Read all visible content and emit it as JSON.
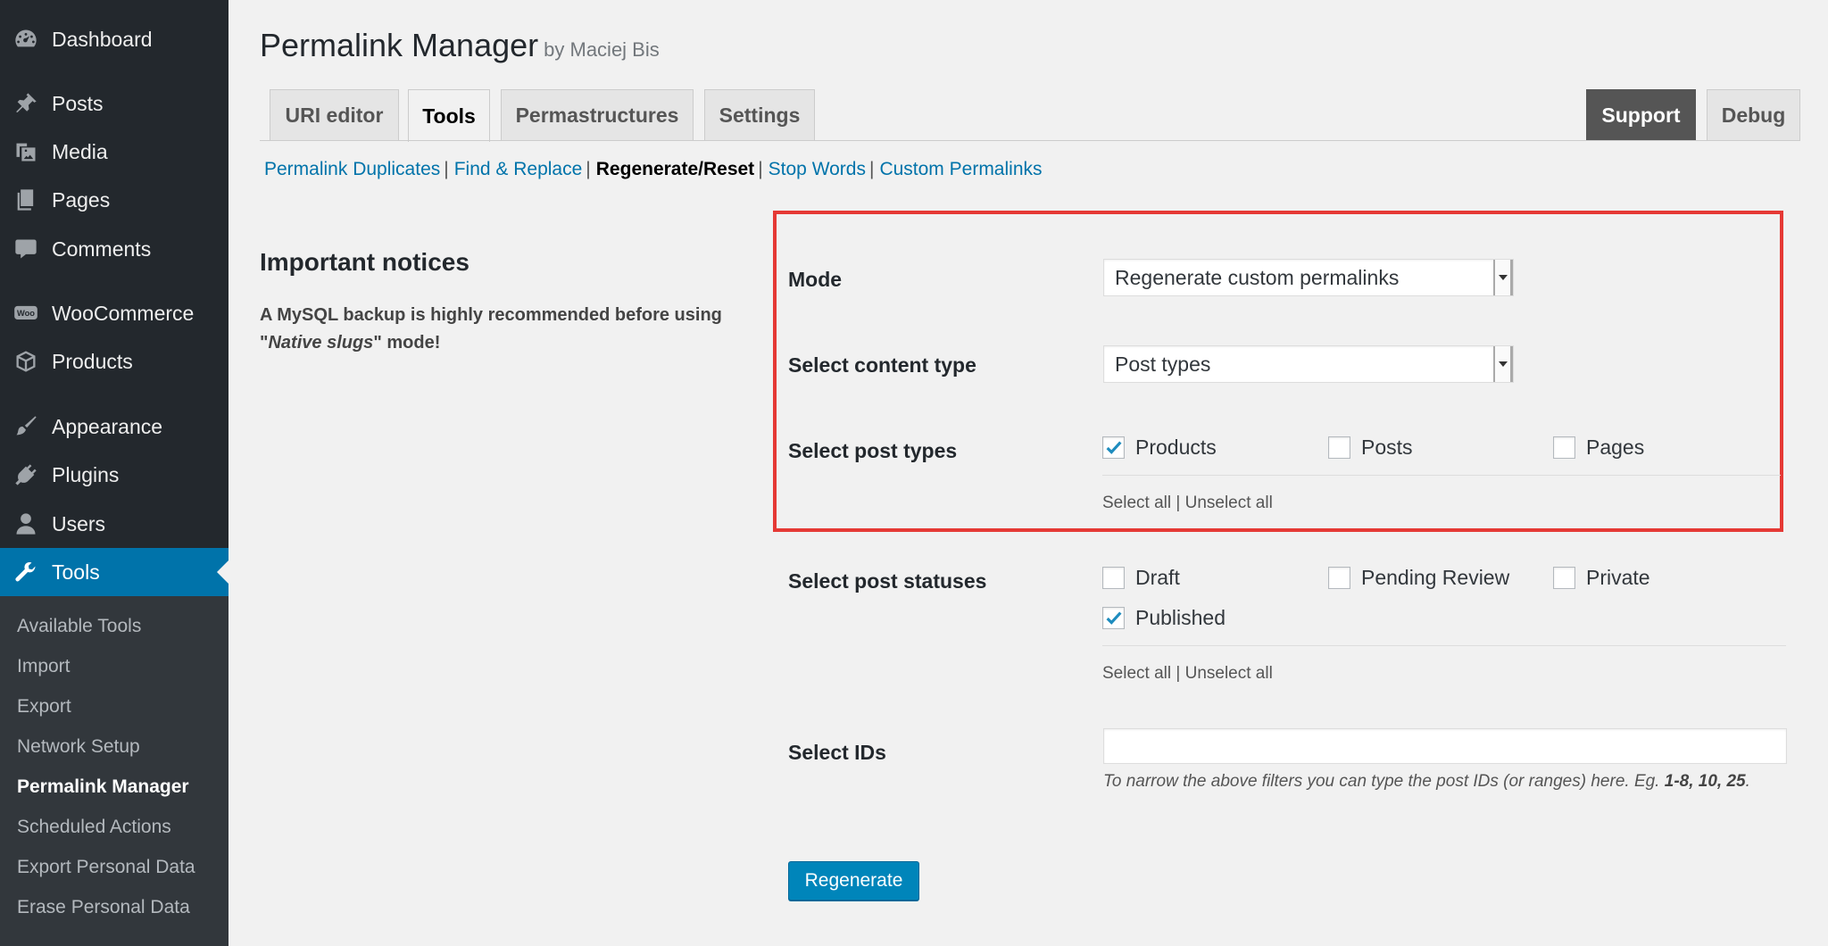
{
  "sidebar": {
    "items": [
      {
        "label": "Dashboard",
        "icon": "dashboard-icon"
      },
      {
        "label": "Posts",
        "icon": "pushpin-icon"
      },
      {
        "label": "Media",
        "icon": "media-icon"
      },
      {
        "label": "Pages",
        "icon": "pages-icon"
      },
      {
        "label": "Comments",
        "icon": "comment-icon"
      },
      {
        "label": "WooCommerce",
        "icon": "woocommerce-icon"
      },
      {
        "label": "Products",
        "icon": "box-icon"
      },
      {
        "label": "Appearance",
        "icon": "paintbrush-icon"
      },
      {
        "label": "Plugins",
        "icon": "plug-icon"
      },
      {
        "label": "Users",
        "icon": "user-icon"
      },
      {
        "label": "Tools",
        "icon": "wrench-icon"
      }
    ],
    "submenu": [
      "Available Tools",
      "Import",
      "Export",
      "Network Setup",
      "Permalink Manager",
      "Scheduled Actions",
      "Export Personal Data",
      "Erase Personal Data"
    ]
  },
  "header": {
    "title": "Permalink Manager",
    "byline": "by Maciej Bis"
  },
  "tabs": [
    "URI editor",
    "Tools",
    "Permastructures",
    "Settings",
    "Support",
    "Debug"
  ],
  "subnav": [
    "Permalink Duplicates",
    "Find & Replace",
    "Regenerate/Reset",
    "Stop Words",
    "Custom Permalinks"
  ],
  "notices": {
    "title": "Important notices",
    "text_before": "A MySQL backup is highly recommended before using \"",
    "text_em": "Native slugs",
    "text_after": "\" mode!"
  },
  "form": {
    "mode_label": "Mode",
    "mode_value": "Regenerate custom permalinks",
    "content_type_label": "Select content type",
    "content_type_value": "Post types",
    "post_types_label": "Select post types",
    "post_types": [
      {
        "label": "Products",
        "checked": true
      },
      {
        "label": "Posts",
        "checked": false
      },
      {
        "label": "Pages",
        "checked": false
      }
    ],
    "statuses_label": "Select post statuses",
    "statuses": [
      {
        "label": "Draft",
        "checked": false
      },
      {
        "label": "Pending Review",
        "checked": false
      },
      {
        "label": "Private",
        "checked": false
      },
      {
        "label": "Published",
        "checked": true
      }
    ],
    "select_all": "Select all",
    "unselect_all": "Unselect all",
    "ids_label": "Select IDs",
    "ids_value": "",
    "ids_hint_before": "To narrow the above filters you can type the post IDs (or ranges) here. Eg. ",
    "ids_hint_bold": "1-8, 10, 25",
    "ids_hint_after": ".",
    "submit_label": "Regenerate"
  },
  "colors": {
    "sidebar_bg": "#23282d",
    "submenu_bg": "#32373c",
    "accent": "#0073aa",
    "highlight": "#e53935",
    "primary_button": "#0085ba"
  }
}
